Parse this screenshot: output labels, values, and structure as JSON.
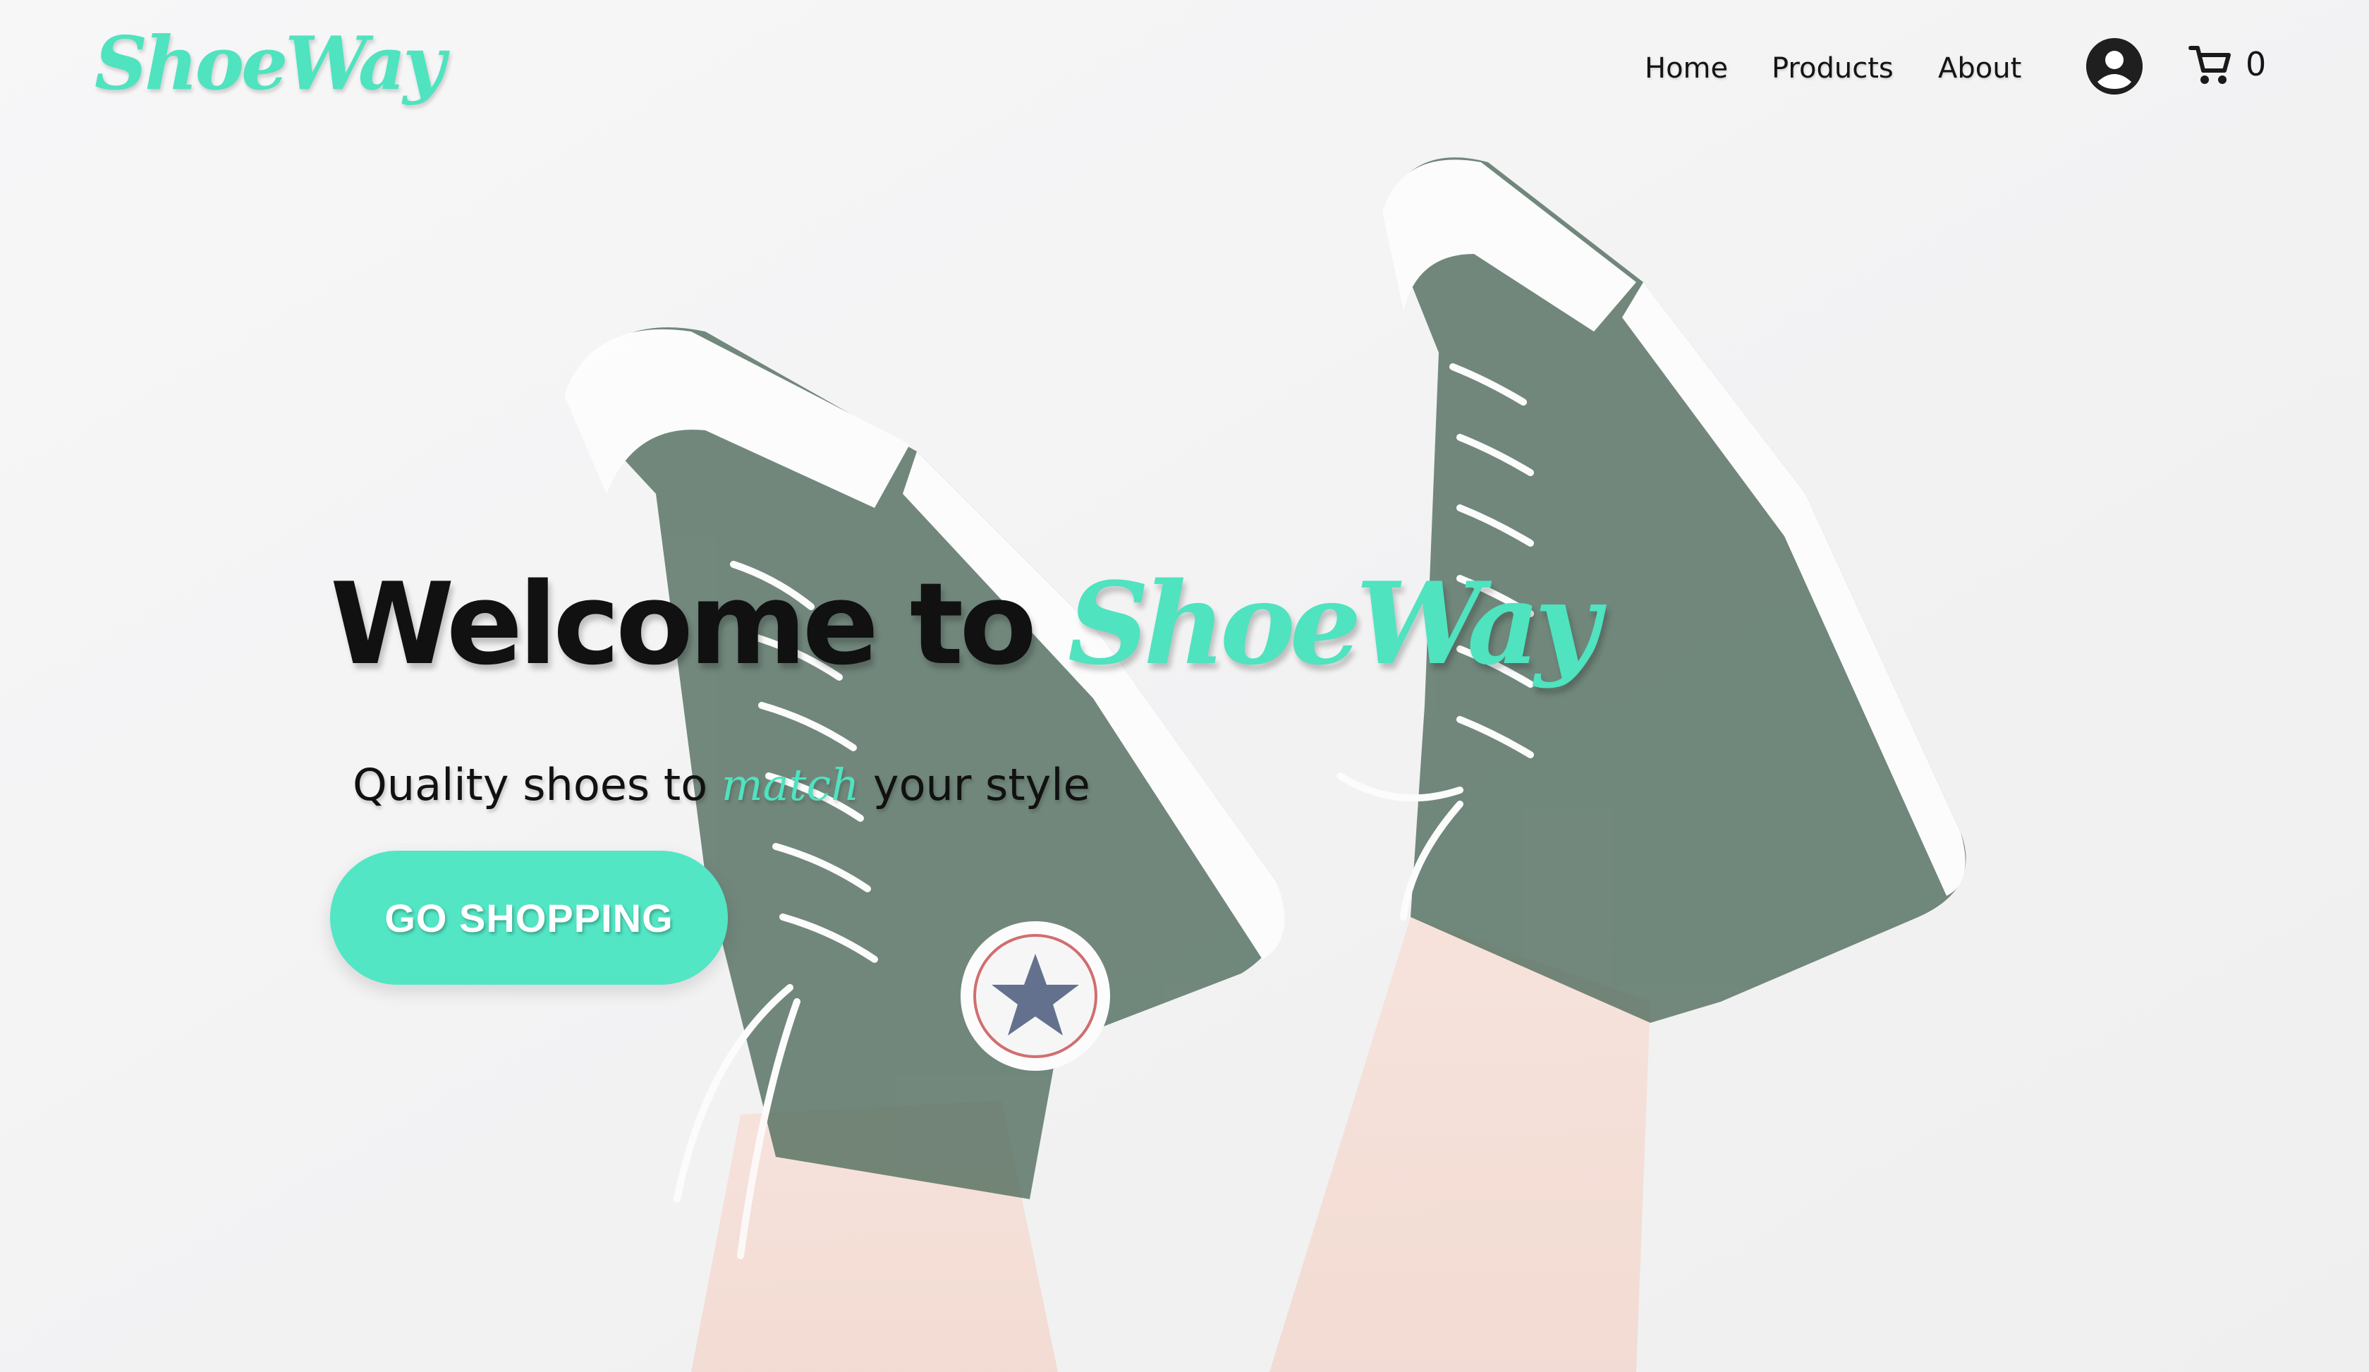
{
  "brand": {
    "logo_text": "ShoeWay",
    "accent_color": "#4fe3bf"
  },
  "nav": {
    "items": [
      {
        "label": "Home"
      },
      {
        "label": "Products"
      },
      {
        "label": "About"
      }
    ],
    "account_icon": "account-circle-icon",
    "cart_icon": "shopping-cart-icon",
    "cart_count": "0"
  },
  "hero": {
    "title_prefix": "Welcome to ",
    "title_brand": "ShoeWay",
    "subtitle_before": "Quality shoes to ",
    "subtitle_accent": "match",
    "subtitle_after": " your style",
    "cta_label": "GO SHOPPING",
    "background_image": "green-high-top-sneakers-photo"
  }
}
